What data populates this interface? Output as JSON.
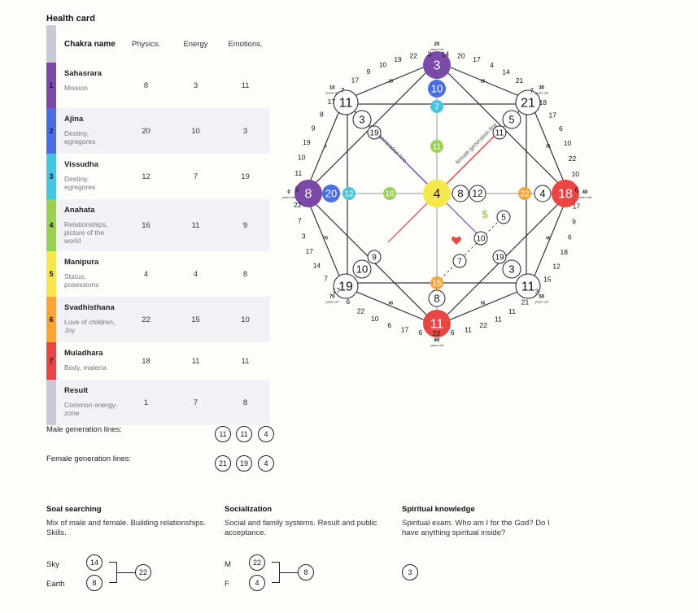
{
  "health_card": {
    "title": "Health card",
    "headers": {
      "name": "Chakra name",
      "physics": "Physics.",
      "energy": "Energy",
      "emotions": "Emotions."
    },
    "rows": [
      {
        "num": "1",
        "name": "Sahasrara",
        "desc": "Mission",
        "physics": "8",
        "energy": "3",
        "emotions": "11",
        "color": "#7b4aa6"
      },
      {
        "num": "2",
        "name": "Ajina",
        "desc": "Destiny, egregores",
        "physics": "20",
        "energy": "10",
        "emotions": "3",
        "color": "#4a6ee0"
      },
      {
        "num": "3",
        "name": "Vissudha",
        "desc": "Destiny, egregores",
        "physics": "12",
        "energy": "7",
        "emotions": "19",
        "color": "#48c4dd"
      },
      {
        "num": "4",
        "name": "Anahata",
        "desc": "Relationships, picture of the world",
        "physics": "16",
        "energy": "11",
        "emotions": "9",
        "color": "#9ccf5a"
      },
      {
        "num": "5",
        "name": "Manipura",
        "desc": "Status, posessions",
        "physics": "4",
        "energy": "4",
        "emotions": "8",
        "color": "#f6e84c"
      },
      {
        "num": "6",
        "name": "Svadhisthana",
        "desc": "Love of children, Joy",
        "physics": "22",
        "energy": "15",
        "emotions": "10",
        "color": "#f5a53a"
      },
      {
        "num": "7",
        "name": "Muladhara",
        "desc": "Body, materia",
        "physics": "18",
        "energy": "11",
        "emotions": "11",
        "color": "#e84545"
      },
      {
        "num": "",
        "name": "Result",
        "desc": "Common energy-zone",
        "physics": "1",
        "energy": "7",
        "emotions": "8",
        "color": "#c9cad6"
      }
    ]
  },
  "generation_lines": {
    "male_label": "Male generation lines:",
    "male": [
      "11",
      "11",
      "4"
    ],
    "female_label": "Female generation lines:",
    "female": [
      "21",
      "19",
      "4"
    ]
  },
  "sections": {
    "soul": {
      "title": "Soal searching",
      "desc": "Mix of male and female. Building relationships. Skills.",
      "top_label": "Sky",
      "top_val": "14",
      "bottom_label": "Earth",
      "bottom_val": "8",
      "result": "22"
    },
    "social": {
      "title": "Socialization",
      "desc": "Social and family systems. Result and public acceptance.",
      "top_label": "M",
      "top_val": "22",
      "bottom_label": "F",
      "bottom_val": "4",
      "result": "8"
    },
    "spiritual": {
      "title": "Spiritual knowledge",
      "desc": "Spiritual exam. Who am I for the God? Do I have anything spiritual inside?",
      "result": "3"
    }
  },
  "matrix": {
    "line_labels": {
      "male": "male generation line",
      "female": "female generation line"
    },
    "dollar": "$",
    "heart_icon": "heart-icon",
    "ages": [
      "0",
      "10",
      "20",
      "30",
      "40",
      "50",
      "60",
      "70"
    ],
    "age_unit": "years old",
    "mid_ages": [
      "5",
      "15",
      "25",
      "35",
      "45",
      "55",
      "65",
      "75"
    ],
    "colors": {
      "purple": "#7b4aa6",
      "blue": "#4a6ee0",
      "cyan": "#48c4dd",
      "green": "#9ccf5a",
      "yellow": "#f6e84c",
      "orange": "#f5a53a",
      "red": "#e84545"
    },
    "nodes": {
      "top1": "3",
      "top2": "10",
      "top3": "7",
      "left1": "8",
      "left2": "20",
      "left3": "12",
      "right1": "18",
      "right2": "4",
      "right3": "22",
      "bottom1": "11",
      "bottom2": "8",
      "bottom3": "15",
      "center": "4",
      "center_r1": "8",
      "center_r2": "12",
      "green_top": "11",
      "green_left": "16",
      "tl1": "11",
      "tl2": "3",
      "tl3": "19",
      "tr1": "21",
      "tr2": "5",
      "tr3": "11",
      "bl1": "19",
      "bl2": "10",
      "bl3": "9",
      "br1": "11",
      "br2": "3",
      "br3": "19",
      "money": "5",
      "love": "10",
      "love2": "7"
    },
    "ring_numbers": [
      {
        "v": "20"
      },
      {
        "v": "17"
      },
      {
        "v": "4"
      },
      {
        "v": "14"
      },
      {
        "v": "21"
      },
      {
        "v": "7"
      },
      {
        "v": "18"
      },
      {
        "v": "17"
      },
      {
        "v": "6"
      },
      {
        "v": "10"
      },
      {
        "v": "22"
      },
      {
        "v": "10"
      },
      {
        "v": "6"
      },
      {
        "v": "17"
      },
      {
        "v": "9"
      },
      {
        "v": "6"
      },
      {
        "v": "18"
      },
      {
        "v": "12"
      },
      {
        "v": "15"
      },
      {
        "v": "3"
      },
      {
        "v": "21"
      },
      {
        "v": "11"
      },
      {
        "v": "11"
      },
      {
        "v": "22"
      },
      {
        "v": "11"
      },
      {
        "v": "6"
      },
      {
        "v": "22"
      },
      {
        "v": "6"
      },
      {
        "v": "17"
      },
      {
        "v": "6"
      },
      {
        "v": "10"
      },
      {
        "v": "22"
      },
      {
        "v": "6"
      },
      {
        "v": "17"
      },
      {
        "v": "7"
      },
      {
        "v": "14"
      },
      {
        "v": "17"
      },
      {
        "v": "3"
      },
      {
        "v": "7"
      },
      {
        "v": "22"
      },
      {
        "v": "5"
      },
      {
        "v": "11"
      },
      {
        "v": "10"
      },
      {
        "v": "19"
      },
      {
        "v": "9"
      },
      {
        "v": "8"
      },
      {
        "v": "17"
      },
      {
        "v": "7"
      },
      {
        "v": "17"
      },
      {
        "v": "9"
      },
      {
        "v": "10"
      },
      {
        "v": "19"
      },
      {
        "v": "22"
      },
      {
        "v": "3"
      },
      {
        "v": "14"
      }
    ]
  }
}
